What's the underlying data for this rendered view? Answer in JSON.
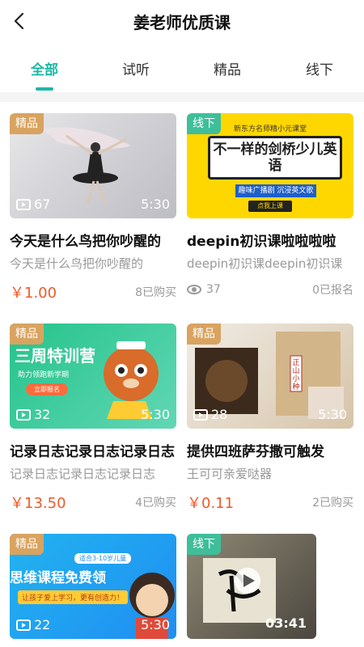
{
  "header": {
    "title": "姜老师优质课"
  },
  "tabs": [
    {
      "label": "全部",
      "active": true
    },
    {
      "label": "试听",
      "active": false
    },
    {
      "label": "精品",
      "active": false
    },
    {
      "label": "线下",
      "active": false
    }
  ],
  "cards": [
    {
      "badge": "精品",
      "title": "今天是什么鸟把你吵醒的",
      "subtitle": "今天是什么鸟把你吵醒的",
      "plays": "67",
      "duration": "5:30",
      "price": "￥1.00",
      "count": "8已购买"
    },
    {
      "badge": "线下",
      "title": "deepin初识课啦啦啦啦",
      "subtitle": "deepin初识课deepin初识课",
      "views": "37",
      "count": "0已报名",
      "thumb_text": {
        "top": "新东方名师精小元课堂",
        "headline": "不一样的剑桥少儿英语",
        "strip": "趣味广播剧 沉浸英文歌",
        "button": "点我上课"
      }
    },
    {
      "badge": "精品",
      "title": "记录日志记录日志记录日志",
      "subtitle": "记录日志记录日志记录日志",
      "plays": "32",
      "duration": "5:30",
      "price": "￥13.50",
      "count": "4已购买",
      "thumb_text": {
        "headline": "三周特训营",
        "sub": "助力领跑新学期",
        "button": "立即报名"
      }
    },
    {
      "badge": "精品",
      "title": "提供四班萨芬撒可触发",
      "subtitle": "王可可亲爱哒器",
      "plays": "28",
      "duration": "5:30",
      "price": "￥0.11",
      "count": "2已购买",
      "thumb_text": {
        "label": "正山小种"
      }
    },
    {
      "badge": "精品",
      "plays": "22",
      "duration": "5:30",
      "thumb_text": {
        "headline": "思维课程免费领",
        "sub": "让孩子爱上学习，更有创造力！",
        "age": "适合3-10岁儿童"
      }
    },
    {
      "badge": "线下",
      "duration": "03:41"
    }
  ],
  "colors": {
    "accent": "#1cb8a6",
    "price": "#f05a28",
    "badge_jingpin": "#d9a360",
    "badge_xianxia": "#3fbe9a"
  }
}
